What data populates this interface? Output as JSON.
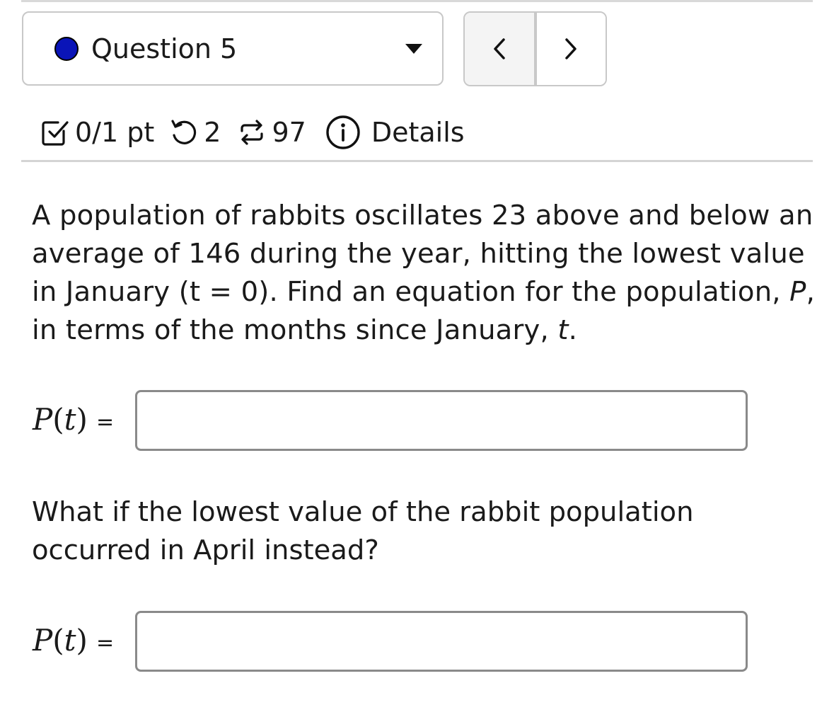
{
  "question_selector": {
    "label": "Question 5"
  },
  "nav": {
    "prev_label": "<",
    "next_label": ">"
  },
  "meta": {
    "score": "0/1 pt",
    "retries": "2",
    "attempts": "97",
    "details": "Details"
  },
  "prompt": {
    "part1": "A population of rabbits oscillates 23 above and below an average of 146 during the year, hitting the lowest value in January (t = 0). Find an equation for the population, ",
    "var_p": "P",
    "part2": ", in terms of the months since January, ",
    "var_t": "t",
    "part3": "."
  },
  "answer1": {
    "label_fn": "P",
    "label_arg": "t",
    "eq": "=",
    "value": ""
  },
  "followup": "What if the lowest value of the rabbit population occurred in April instead?",
  "answer2": {
    "label_fn": "P",
    "label_arg": "t",
    "eq": "=",
    "value": ""
  }
}
